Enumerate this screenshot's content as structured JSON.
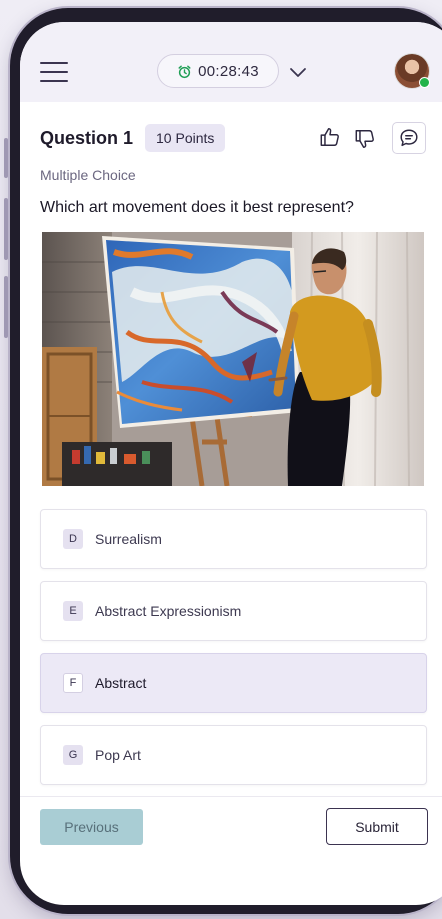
{
  "topbar": {
    "timer": "00:28:43",
    "icons": {
      "menu": "hamburger-menu-icon",
      "timer": "alarm-clock-icon",
      "expand": "chevron-down-icon"
    },
    "colors": {
      "timer_icon": "#1f9e55",
      "online_dot": "#23b34a"
    }
  },
  "question": {
    "title": "Question 1",
    "points": "10 Points",
    "type": "Multiple Choice",
    "text": "Which art movement does it best represent?",
    "actions": [
      "thumbs-up-icon",
      "thumbs-down-icon",
      "comment-icon"
    ]
  },
  "options": [
    {
      "letter": "D",
      "label": "Surrealism",
      "selected": false
    },
    {
      "letter": "E",
      "label": "Abstract Expressionism",
      "selected": false
    },
    {
      "letter": "F",
      "label": "Abstract",
      "selected": true
    },
    {
      "letter": "G",
      "label": "Pop Art",
      "selected": false
    }
  ],
  "footer": {
    "previous_label": "Previous",
    "submit_label": "Submit",
    "colors": {
      "previous_bg": "#a9cdd4",
      "submit_border": "#3b3350"
    }
  }
}
